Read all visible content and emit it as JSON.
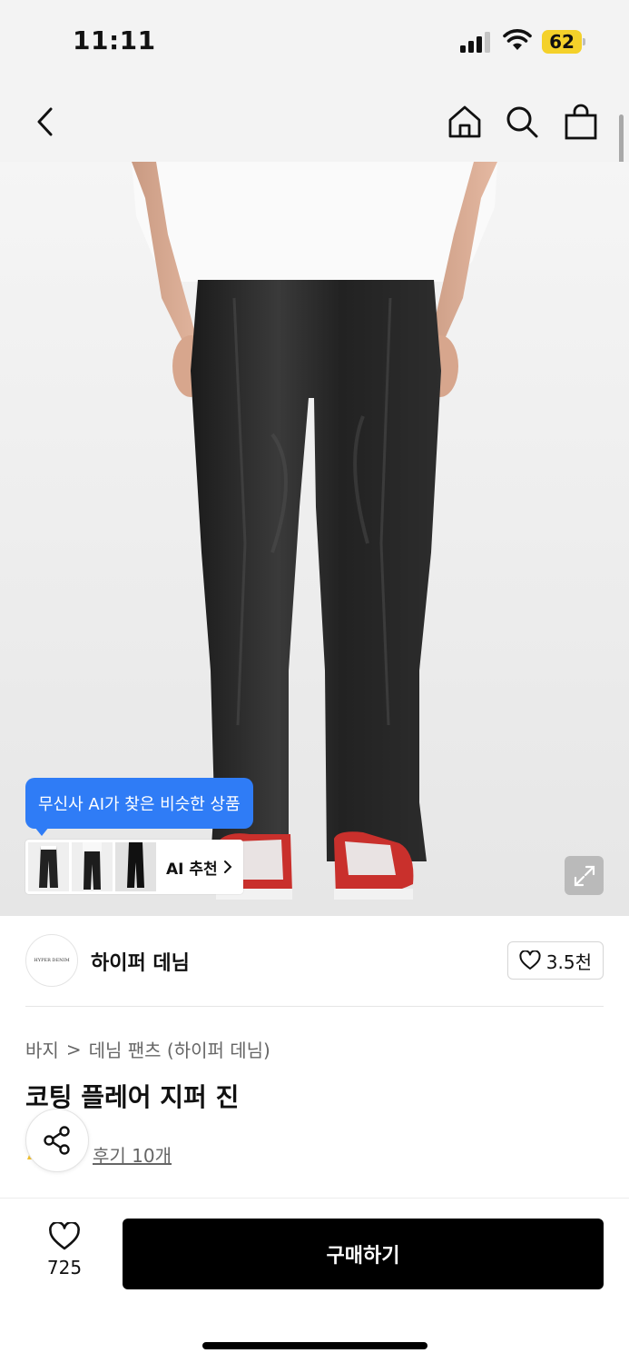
{
  "status_bar": {
    "time": "11:11",
    "battery": "62"
  },
  "nav": {
    "icons": [
      "back-icon",
      "home-icon",
      "search-icon",
      "shopping-bag-icon"
    ]
  },
  "ai_recommend": {
    "tooltip": "무신사 AI가 찾은 비슷한 상품",
    "label": "AI 추천",
    "thumb_count": 3
  },
  "brand": {
    "name": "하이퍼 데님",
    "logo_text": "HYPER DENIM",
    "likes": "3.5천"
  },
  "breadcrumb": {
    "category": "바지",
    "separator": ">",
    "subcategory": "데님 팬츠 (하이퍼 데님)"
  },
  "product": {
    "title": "코팅 플레어 지퍼 진",
    "reviews": "후기 10개"
  },
  "bottom": {
    "wish_count": "725",
    "buy_label": "구매하기"
  },
  "colors": {
    "accent_blue": "#2f7cf6",
    "battery_yellow": "#f4d12a",
    "buy_button": "#000000"
  }
}
